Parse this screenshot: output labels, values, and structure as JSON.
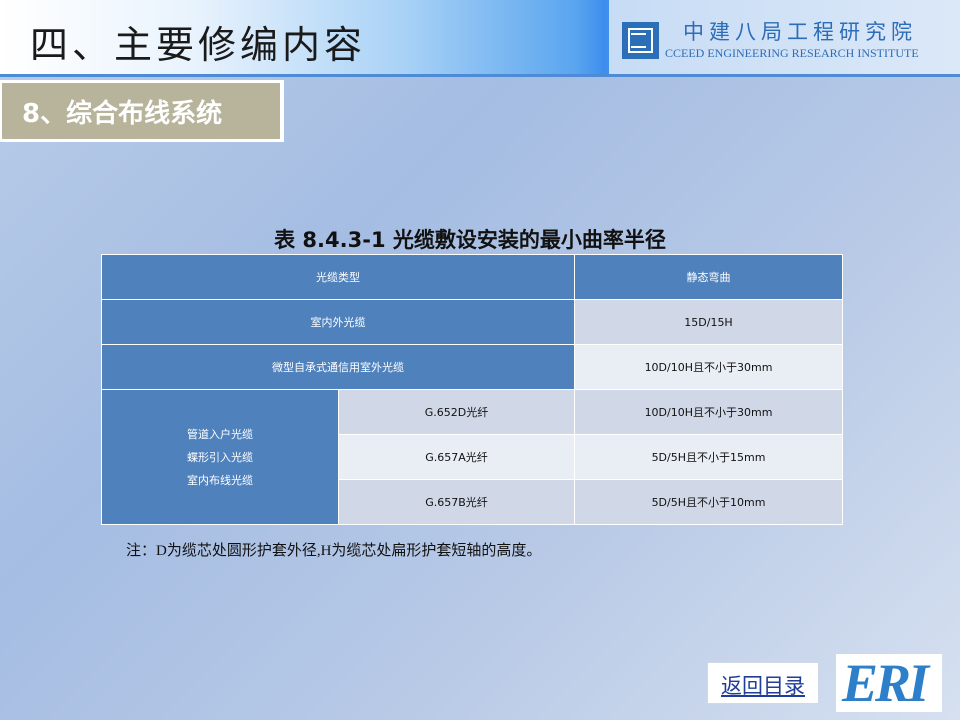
{
  "header": {
    "title": "四、主要修编内容",
    "org_name_cn": "中建八局工程研究院",
    "org_name_en": "CCEED ENGINEERING RESEARCH INSTITUTE"
  },
  "section": {
    "label": "8、综合布线系统"
  },
  "table": {
    "caption": "表 8.4.3-1    光缆敷设安装的最小曲率半径",
    "headers": [
      "光缆类型",
      "静态弯曲"
    ],
    "rows": [
      {
        "type": "室内外光缆",
        "value": "15D/15H"
      },
      {
        "type": "微型自承式通信用室外光缆",
        "value": "10D/10H且不小于30mm"
      }
    ],
    "group": {
      "types": [
        "管道入户光缆",
        "蝶形引入光缆",
        "室内布线光缆"
      ],
      "sub_rows": [
        {
          "fiber": "G.652D光纤",
          "value": "10D/10H且不小于30mm"
        },
        {
          "fiber": "G.657A光纤",
          "value": "5D/5H且不小于15mm"
        },
        {
          "fiber": "G.657B光纤",
          "value": "5D/5H且不小于10mm"
        }
      ]
    }
  },
  "note": "注：D为缆芯处圆形护套外径,H为缆芯处扁形护套短轴的高度。",
  "nav": {
    "back_label": "返回目录",
    "logo_text": "ERI"
  },
  "colors": {
    "table_header": "#4f81bd",
    "row_light_1": "#d0d8e8",
    "row_light_2": "#e9edf4",
    "section_bg": "#b7b49b",
    "link": "#1f3d99"
  }
}
